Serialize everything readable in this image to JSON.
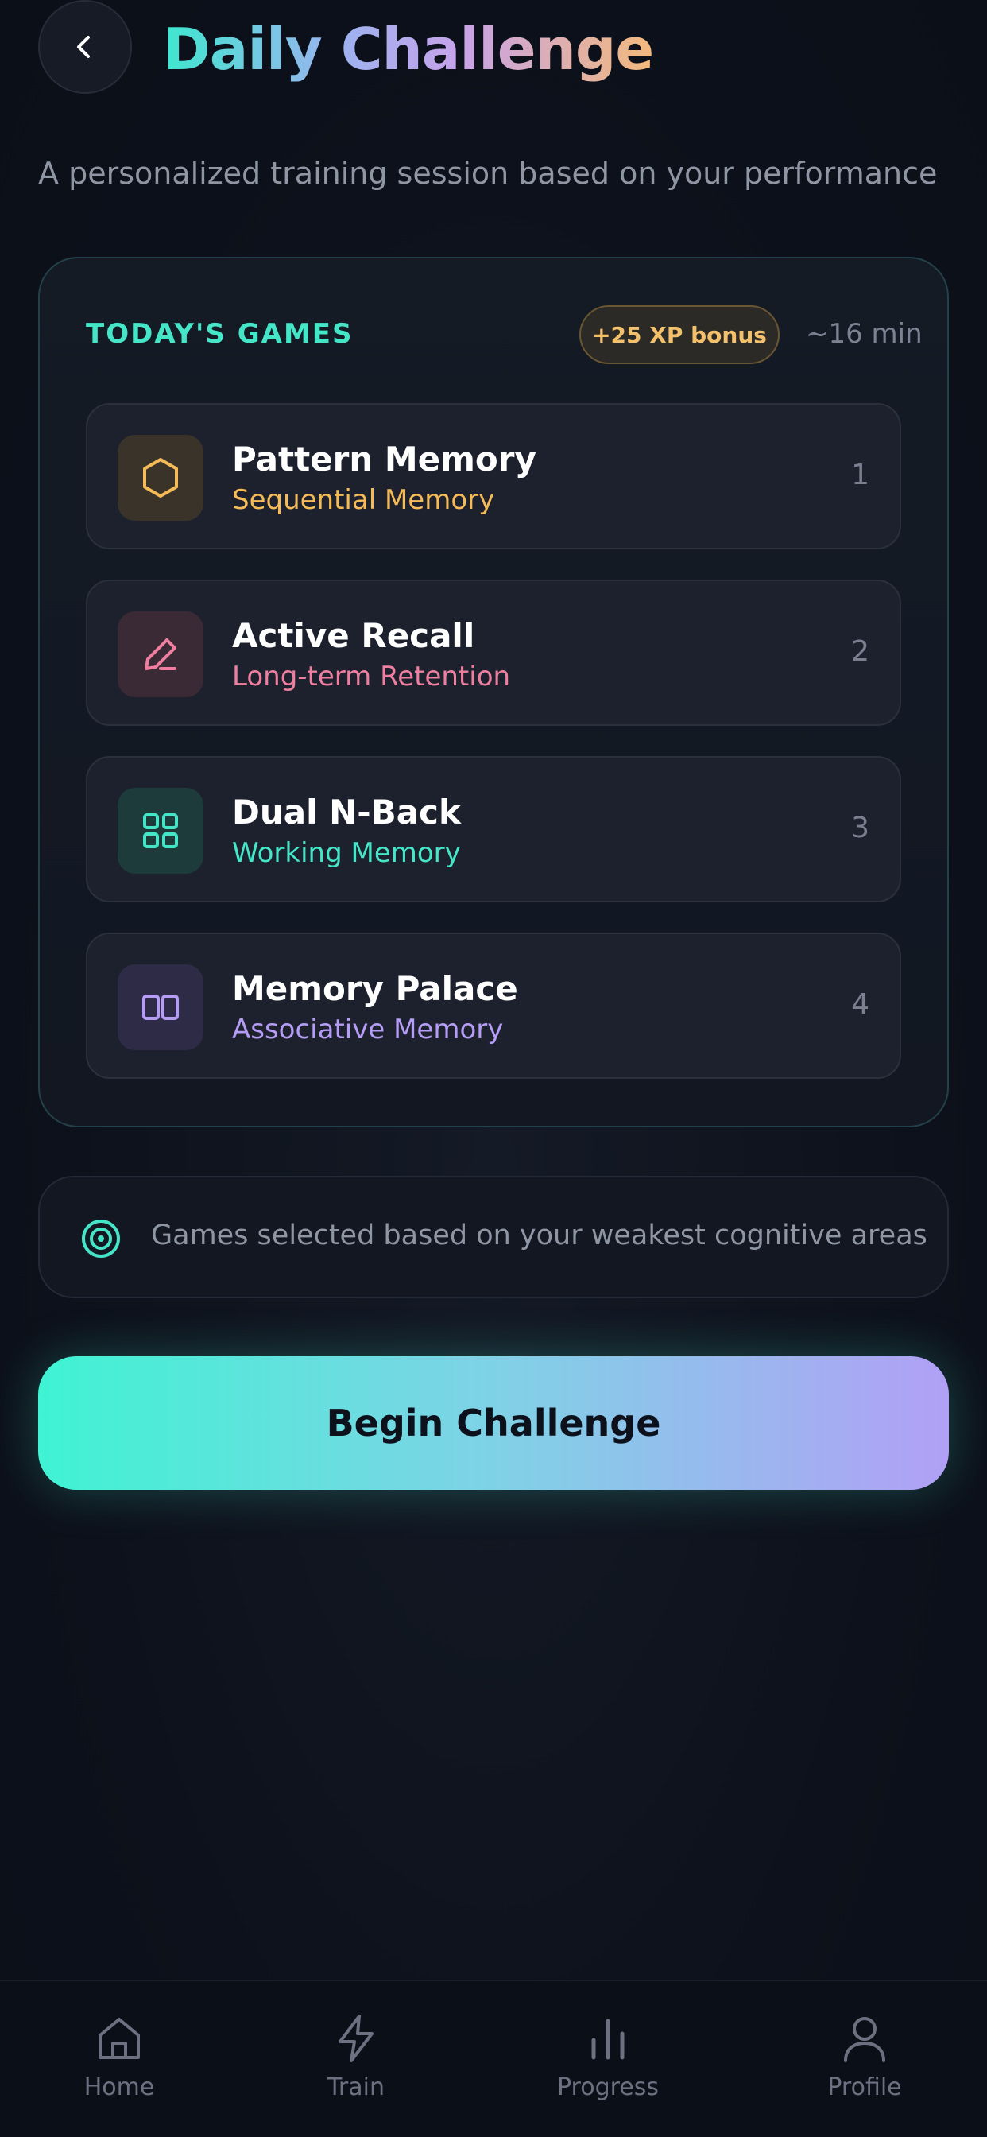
{
  "header": {
    "title": "Daily Challenge",
    "subtitle": "A personalized training session based on your performance"
  },
  "games_card": {
    "heading": "TODAY'S GAMES",
    "xp_bonus": "+25 XP bonus",
    "duration": "~16 min",
    "games": [
      {
        "name": "Pattern Memory",
        "type": "Sequential Memory",
        "number": "1",
        "icon": "hexagon-icon",
        "color": "#f5bb57"
      },
      {
        "name": "Active Recall",
        "type": "Long-term Retention",
        "number": "2",
        "icon": "pencil-icon",
        "color": "#ef7fa0"
      },
      {
        "name": "Dual N-Back",
        "type": "Working Memory",
        "number": "3",
        "icon": "grid-icon",
        "color": "#45e6c8"
      },
      {
        "name": "Memory Palace",
        "type": "Associative Memory",
        "number": "4",
        "icon": "columns-icon",
        "color": "#b59cf5"
      }
    ]
  },
  "info": {
    "text": "Games selected based on your weakest cognitive areas",
    "icon": "target-icon"
  },
  "cta": {
    "label": "Begin Challenge"
  },
  "nav": {
    "items": [
      {
        "label": "Home",
        "icon": "home-icon"
      },
      {
        "label": "Train",
        "icon": "lightning-icon"
      },
      {
        "label": "Progress",
        "icon": "bar-chart-icon"
      },
      {
        "label": "Profile",
        "icon": "user-icon"
      }
    ]
  },
  "colors": {
    "accent_teal": "#45e6c8",
    "xp_gold": "#f3c06b",
    "background": "#0d111b"
  }
}
